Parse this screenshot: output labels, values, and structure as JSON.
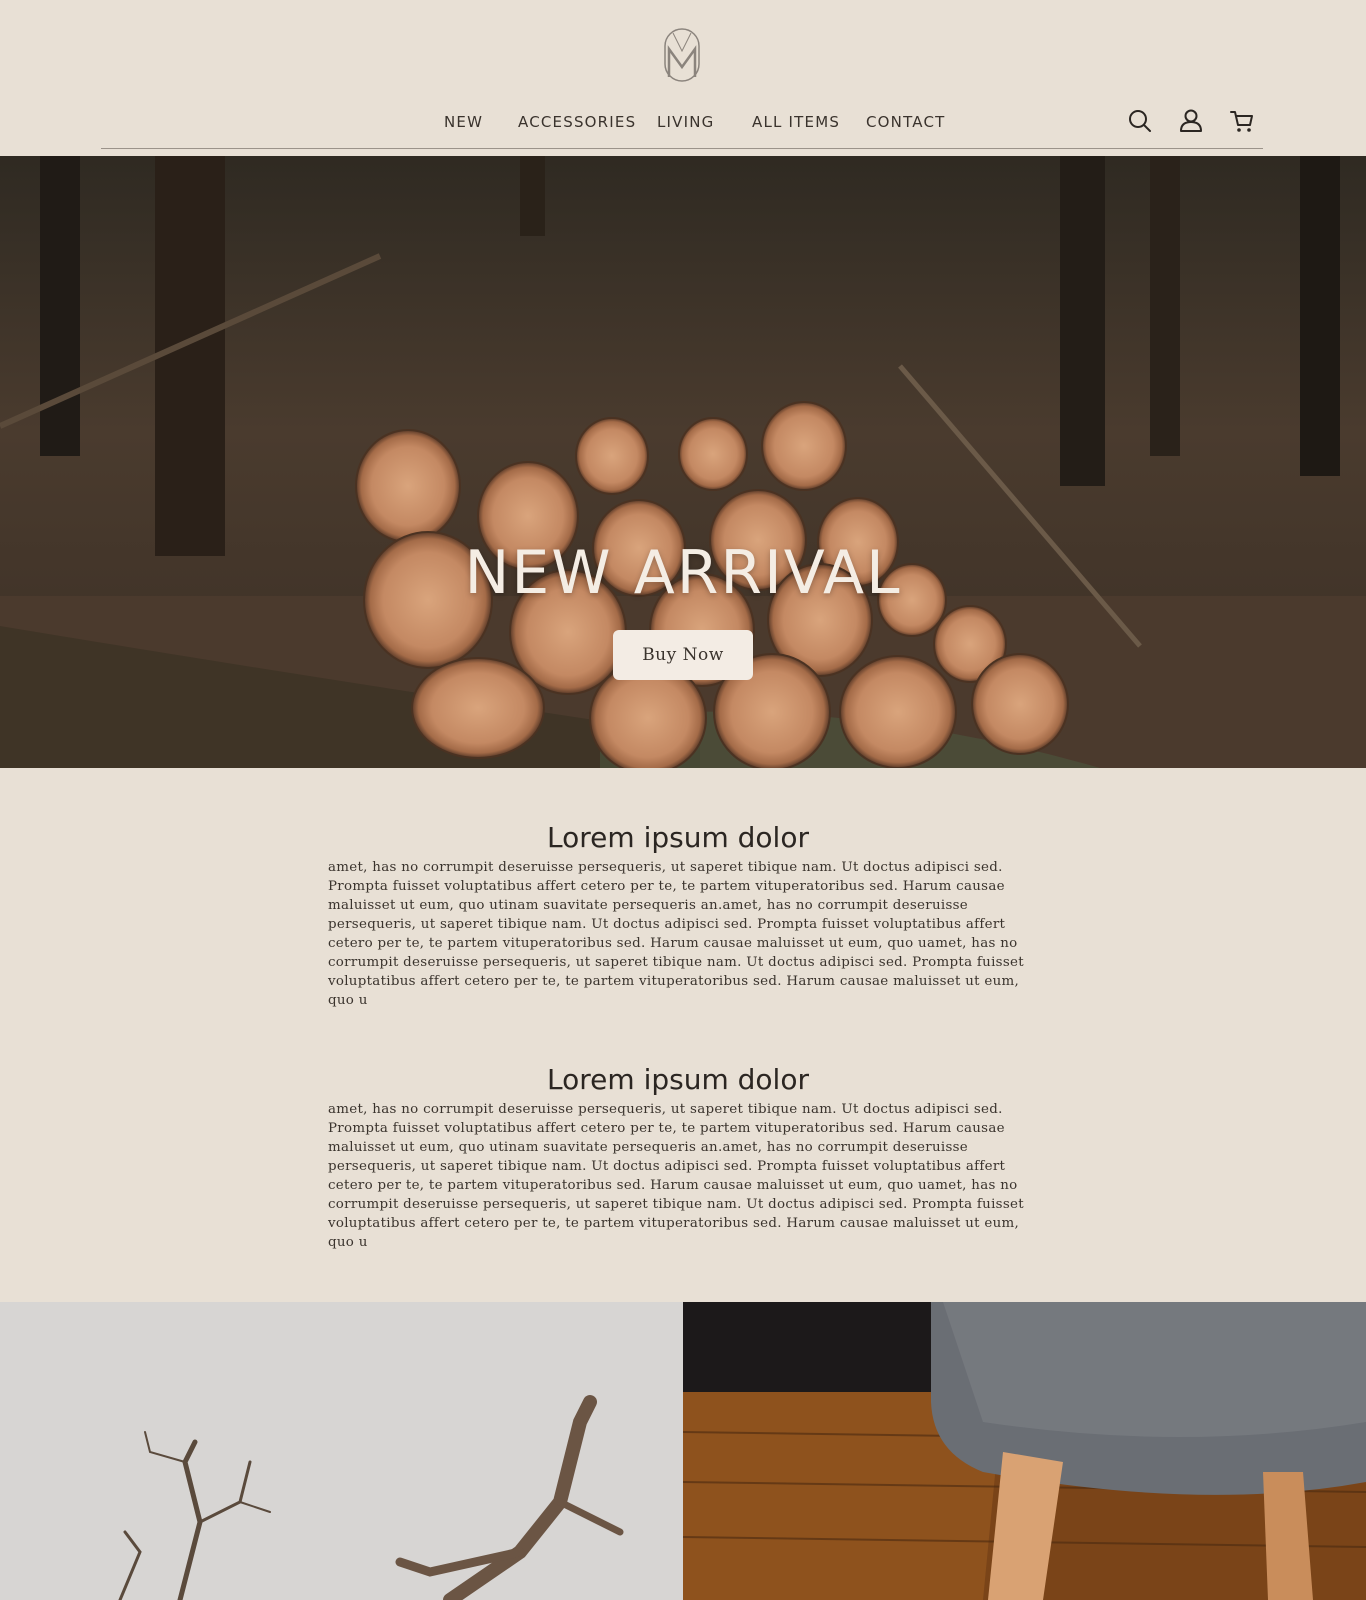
{
  "brand": {
    "logo_icon": "monogram-m-icon"
  },
  "nav": {
    "items": [
      {
        "label": "NEW"
      },
      {
        "label": "ACCESSORIES"
      },
      {
        "label": "LIVING"
      },
      {
        "label": "ALL ITEMS"
      },
      {
        "label": "CONTACT"
      }
    ],
    "icons": [
      "search-icon",
      "user-icon",
      "cart-icon"
    ]
  },
  "hero": {
    "title": "NEW ARRIVAL",
    "button_label": "Buy Now",
    "image": "stacked-logs-forest-photo"
  },
  "sections": [
    {
      "heading": "Lorem ipsum dolor",
      "body": "amet, has no corrumpit deseruisse persequeris, ut saperet tibique nam. Ut doctus adipisci sed. Prompta fuisset voluptatibus affert cetero per te, te partem vituperatoribus sed. Harum causae maluisset ut eum, quo utinam suavitate persequeris an.amet, has no corrumpit deseruisse persequeris, ut saperet tibique nam. Ut doctus adipisci sed. Prompta fuisset voluptatibus affert cetero per te, te partem vituperatoribus sed. Harum causae maluisset ut eum, quo uamet, has no corrumpit deseruisse persequeris, ut saperet tibique nam. Ut doctus adipisci sed. Prompta fuisset voluptatibus affert cetero per te, te partem vituperatoribus sed. Harum causae maluisset ut eum, quo u"
    },
    {
      "heading": "Lorem ipsum dolor",
      "body": "amet, has no corrumpit deseruisse persequeris, ut saperet tibique nam. Ut doctus adipisci sed. Prompta fuisset voluptatibus affert cetero per te, te partem vituperatoribus sed. Harum causae maluisset ut eum, quo utinam suavitate persequeris an.amet, has no corrumpit deseruisse persequeris, ut saperet tibique nam. Ut doctus adipisci sed. Prompta fuisset voluptatibus affert cetero per te, te partem vituperatoribus sed. Harum causae maluisset ut eum, quo uamet, has no corrumpit deseruisse persequeris, ut saperet tibique nam. Ut doctus adipisci sed. Prompta fuisset voluptatibus affert cetero per te, te partem vituperatoribus sed. Harum causae maluisset ut eum, quo u"
    }
  ],
  "gallery": [
    {
      "image": "driftwood-branches-photo"
    },
    {
      "image": "upholstered-stool-wood-floor-photo"
    }
  ],
  "colors": {
    "background": "#e8e0d5",
    "text": "#2b2622",
    "hero_button": "#f3ece4",
    "hero_text": "#f4ede4"
  }
}
